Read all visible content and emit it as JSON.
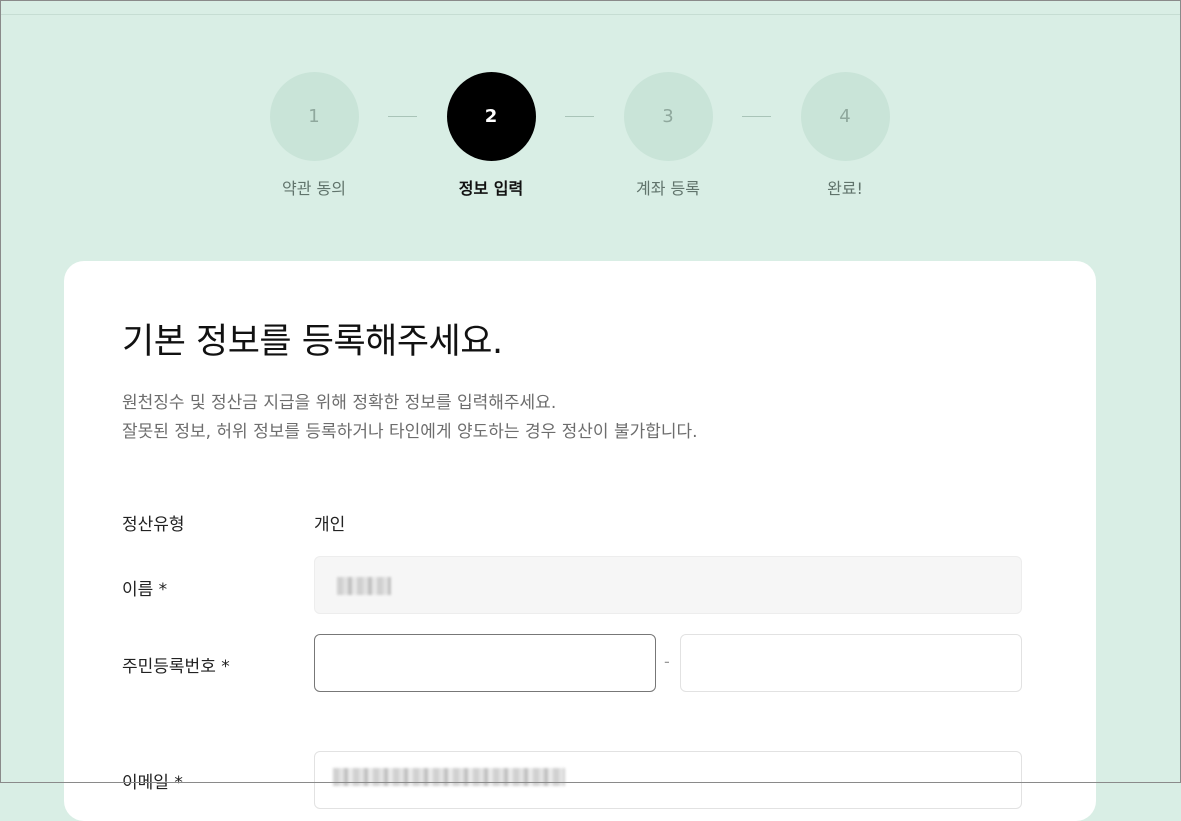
{
  "stepper": {
    "steps": [
      {
        "number": "1",
        "label": "약관 동의",
        "active": false
      },
      {
        "number": "2",
        "label": "정보 입력",
        "active": true
      },
      {
        "number": "3",
        "label": "계좌 등록",
        "active": false
      },
      {
        "number": "4",
        "label": "완료!",
        "active": false
      }
    ]
  },
  "card": {
    "title": "기본 정보를 등록해주세요.",
    "description_line1": "원천징수 및 정산금 지급을 위해 정확한 정보를 입력해주세요.",
    "description_line2": "잘못된 정보, 허위 정보를 등록하거나 타인에게 양도하는 경우 정산이 불가합니다."
  },
  "form": {
    "settlement_type_label": "정산유형",
    "settlement_type_value": "개인",
    "name_label": "이름 *",
    "rrn_label": "주민등록번호 *",
    "rrn_separator": "-",
    "email_label": "이메일 *"
  },
  "colors": {
    "background": "#d9eee5",
    "active_step": "#000000",
    "inactive_step": "#c9e4d8"
  }
}
